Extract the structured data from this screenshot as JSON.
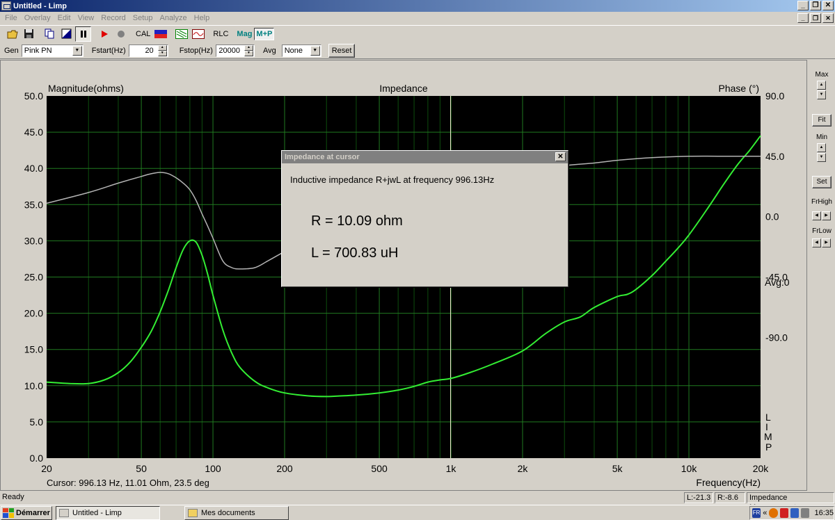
{
  "window": {
    "title": "Untitled - Limp"
  },
  "menu": [
    "File",
    "Overlay",
    "Edit",
    "View",
    "Record",
    "Setup",
    "Analyze",
    "Help"
  ],
  "toolbar": {
    "cal": "CAL",
    "rlc": "RLC",
    "mag": "Mag",
    "mp": "M+P"
  },
  "controls": {
    "gen_label": "Gen",
    "gen_value": "Pink PN",
    "fstart_label": "Fstart(Hz)",
    "fstart_value": "20",
    "fstop_label": "Fstop(Hz)",
    "fstop_value": "20000",
    "avg_label": "Avg",
    "avg_value": "None",
    "reset_label": "Reset"
  },
  "right_panel": {
    "max": "Max",
    "fit": "Fit",
    "min": "Min",
    "set": "Set",
    "frhigh": "FrHigh",
    "frlow": "FrLow"
  },
  "plot": {
    "left_title": "Magnitude(ohms)",
    "center_title": "Impedance",
    "right_title": "Phase (°)",
    "avg_text": "Avg:0",
    "limp_letters": [
      "L",
      "I",
      "M",
      "P"
    ],
    "cursor_text": "Cursor: 996.13 Hz, 11.01 Ohm, 23.5 deg",
    "x_title": "Frequency(Hz)"
  },
  "chart_data": {
    "type": "line",
    "title": "Impedance",
    "xlabel": "Frequency(Hz)",
    "ylabel": "Magnitude(ohms)",
    "y2label": "Phase (°)",
    "xscale": "log",
    "xlim": [
      20,
      20000
    ],
    "ylim": [
      0,
      50
    ],
    "y2lim": [
      -180,
      90
    ],
    "x_ticks": [
      20,
      50,
      100,
      200,
      500,
      1000,
      2000,
      5000,
      10000,
      20000
    ],
    "x_tick_labels": [
      "20",
      "50",
      "100",
      "200",
      "500",
      "1k",
      "2k",
      "5k",
      "10k",
      "20k"
    ],
    "y_tick_labels": [
      "0.0",
      "5.0",
      "10.0",
      "15.0",
      "20.0",
      "25.0",
      "30.0",
      "35.0",
      "40.0",
      "45.0",
      "50.0"
    ],
    "y2_ticks": [
      90,
      45,
      0,
      -45,
      -90
    ],
    "y2_tick_labels": [
      "90.0",
      "45.0",
      "0.0",
      "-45.0",
      "-90.0"
    ],
    "grid": true,
    "cursor_x": 996.13,
    "series": [
      {
        "color": "#33ee33",
        "axis": "left",
        "x": [
          20,
          25,
          30,
          35,
          40,
          45,
          50,
          55,
          60,
          65,
          70,
          75,
          80,
          85,
          90,
          95,
          100,
          110,
          120,
          130,
          150,
          170,
          200,
          250,
          300,
          350,
          400,
          500,
          600,
          700,
          800,
          900,
          1000,
          1200,
          1500,
          2000,
          2500,
          3000,
          3500,
          4000,
          5000,
          5500,
          6000,
          7000,
          8000,
          9000,
          10000,
          12000,
          14000,
          16000,
          18000,
          20000
        ],
        "values": [
          10.5,
          10.3,
          10.3,
          10.8,
          11.8,
          13.3,
          15.3,
          17.5,
          20.2,
          23.2,
          26.3,
          28.8,
          30.0,
          29.8,
          28.0,
          25.4,
          22.5,
          17.7,
          14.5,
          12.5,
          10.6,
          9.7,
          9.0,
          8.6,
          8.5,
          8.6,
          8.7,
          9.0,
          9.4,
          9.9,
          10.5,
          10.8,
          11.0,
          11.8,
          13.0,
          14.8,
          17.2,
          18.8,
          19.5,
          20.8,
          22.3,
          22.6,
          23.3,
          25.2,
          27.2,
          29.0,
          30.8,
          34.5,
          37.8,
          40.5,
          42.5,
          44.5
        ]
      },
      {
        "color": "#b4b4b4",
        "axis": "right",
        "x": [
          20,
          30,
          40,
          50,
          55,
          60,
          65,
          70,
          75,
          80,
          85,
          90,
          95,
          100,
          110,
          120,
          130,
          150,
          170,
          200,
          250,
          300,
          400,
          500,
          700,
          1000,
          1500,
          2000,
          3000,
          4000,
          5000,
          7000,
          10000,
          15000,
          20000
        ],
        "values": [
          10,
          18,
          25,
          30,
          32,
          33,
          32,
          29,
          25,
          20,
          12,
          2,
          -7,
          -16,
          -33,
          -38,
          -39,
          -38,
          -33,
          -26,
          -17,
          -10,
          0,
          5,
          12,
          20,
          28,
          33,
          38,
          40,
          42,
          44,
          45,
          45,
          45
        ]
      }
    ]
  },
  "dialog": {
    "title": "Impedance at cursor",
    "message": "Inductive impedance R+jwL at frequency 996.13Hz",
    "r_text": "R = 10.09 ohm",
    "l_text": "L = 700.83 uH"
  },
  "status": {
    "ready": "Ready",
    "l": "L:-21.3",
    "r": "R:-8.6",
    "mode": "Impedance Measurement"
  },
  "taskbar": {
    "start": "Démarrer",
    "task1": "Untitled - Limp",
    "task2": "Mes documents",
    "lang": "FR",
    "clock": "16:35"
  }
}
